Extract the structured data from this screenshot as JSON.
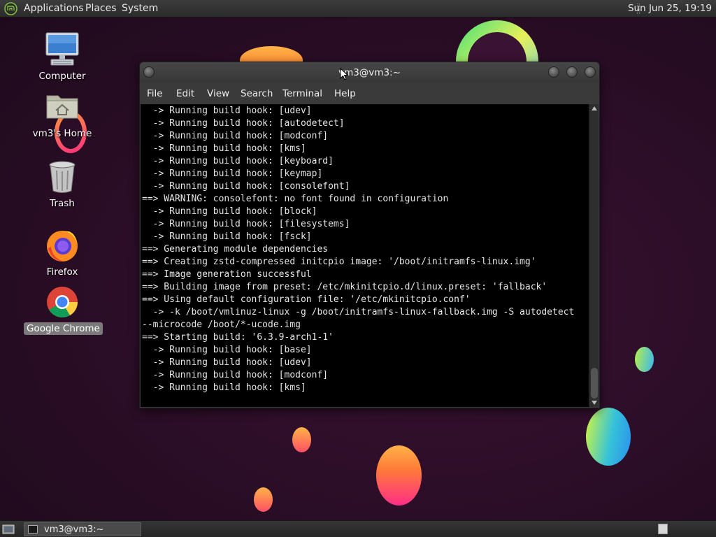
{
  "top_panel": {
    "logo_icon": "distro-logo-icon",
    "menus": [
      "Applications",
      "Places",
      "System"
    ],
    "clock": "Sun Jun 25, 19:19"
  },
  "desktop": {
    "icons": [
      {
        "label": "Computer",
        "icon": "computer-icon"
      },
      {
        "label": "vm3's Home",
        "icon": "home-folder-icon"
      },
      {
        "label": "Trash",
        "icon": "trash-icon"
      },
      {
        "label": "Firefox",
        "icon": "firefox-icon"
      },
      {
        "label": "Google Chrome",
        "icon": "chrome-icon"
      }
    ]
  },
  "terminal": {
    "title": "vm3@vm3:~",
    "menu": [
      "File",
      "Edit",
      "View",
      "Search",
      "Terminal",
      "Help"
    ],
    "lines": [
      "  -> Running build hook: [udev]",
      "  -> Running build hook: [autodetect]",
      "  -> Running build hook: [modconf]",
      "  -> Running build hook: [kms]",
      "  -> Running build hook: [keyboard]",
      "  -> Running build hook: [keymap]",
      "  -> Running build hook: [consolefont]",
      "==> WARNING: consolefont: no font found in configuration",
      "  -> Running build hook: [block]",
      "  -> Running build hook: [filesystems]",
      "  -> Running build hook: [fsck]",
      "==> Generating module dependencies",
      "==> Creating zstd-compressed initcpio image: '/boot/initramfs-linux.img'",
      "==> Image generation successful",
      "==> Building image from preset: /etc/mkinitcpio.d/linux.preset: 'fallback'",
      "==> Using default configuration file: '/etc/mkinitcpio.conf'",
      "  -> -k /boot/vmlinuz-linux -g /boot/initramfs-linux-fallback.img -S autodetect",
      "--microcode /boot/*-ucode.img",
      "==> Starting build: '6.3.9-arch1-1'",
      "  -> Running build hook: [base]",
      "  -> Running build hook: [udev]",
      "  -> Running build hook: [modconf]",
      "  -> Running build hook: [kms]"
    ]
  },
  "bottom_panel": {
    "taskbar_item": "vm3@vm3:~"
  },
  "colors": {
    "background": "#2a0d24",
    "panel": "#2f2f2f",
    "terminal_bg": "#000000",
    "terminal_fg": "#e6e6e6"
  }
}
